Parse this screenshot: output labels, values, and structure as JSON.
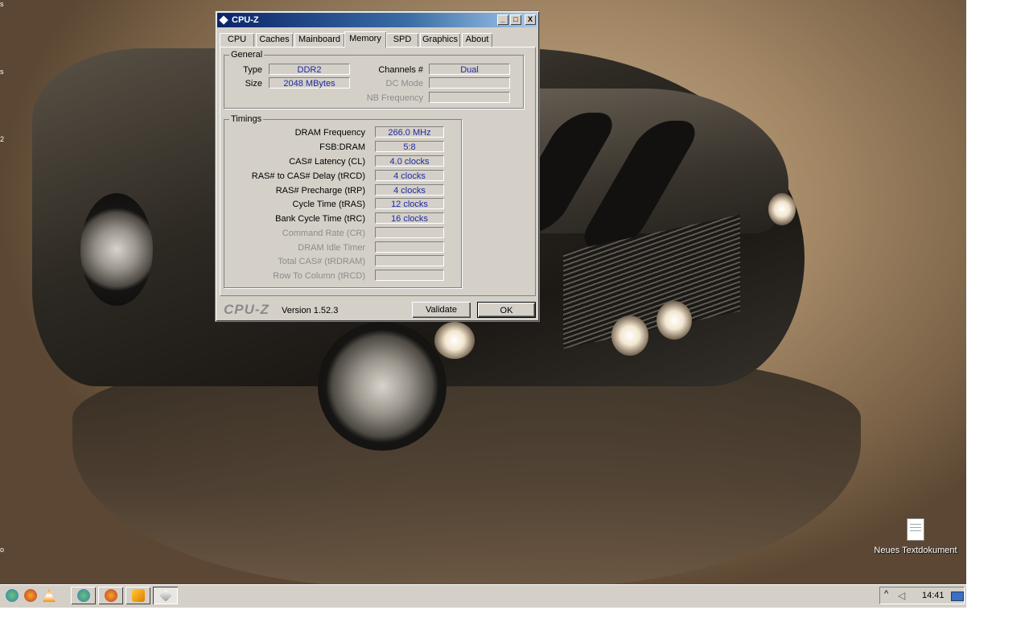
{
  "window": {
    "title": "CPU-Z",
    "controls": {
      "minimize": "_",
      "maximize": "□",
      "close": "X"
    },
    "tabs": [
      {
        "label": "CPU"
      },
      {
        "label": "Caches"
      },
      {
        "label": "Mainboard"
      },
      {
        "label": "Memory",
        "active": true
      },
      {
        "label": "SPD"
      },
      {
        "label": "Graphics"
      },
      {
        "label": "About"
      }
    ],
    "general": {
      "legend": "General",
      "type_label": "Type",
      "type_value": "DDR2",
      "size_label": "Size",
      "size_value": "2048 MBytes",
      "channels_label": "Channels #",
      "channels_value": "Dual",
      "dc_mode_label": "DC Mode",
      "dc_mode_value": "",
      "nb_freq_label": "NB Frequency",
      "nb_freq_value": ""
    },
    "timings": {
      "legend": "Timings",
      "rows": [
        {
          "label": "DRAM Frequency",
          "value": "266.0 MHz",
          "enabled": true
        },
        {
          "label": "FSB:DRAM",
          "value": "5:8",
          "enabled": true
        },
        {
          "label": "CAS# Latency (CL)",
          "value": "4.0 clocks",
          "enabled": true
        },
        {
          "label": "RAS# to CAS# Delay (tRCD)",
          "value": "4 clocks",
          "enabled": true
        },
        {
          "label": "RAS# Precharge (tRP)",
          "value": "4 clocks",
          "enabled": true
        },
        {
          "label": "Cycle Time (tRAS)",
          "value": "12 clocks",
          "enabled": true
        },
        {
          "label": "Bank Cycle Time (tRC)",
          "value": "16 clocks",
          "enabled": true
        },
        {
          "label": "Command Rate (CR)",
          "value": "",
          "enabled": false
        },
        {
          "label": "DRAM Idle Timer",
          "value": "",
          "enabled": false
        },
        {
          "label": "Total CAS# (tRDRAM)",
          "value": "",
          "enabled": false
        },
        {
          "label": "Row To Column (tRCD)",
          "value": "",
          "enabled": false
        }
      ]
    },
    "footer": {
      "logo": "CPU-Z",
      "version": "Version 1.52.3",
      "validate_label": "Validate",
      "ok_label": "OK"
    }
  },
  "desktop": {
    "icons": [
      {
        "label": "Neues Textdokument"
      }
    ],
    "edge_marks": [
      "s",
      "s",
      "2",
      "o"
    ]
  },
  "taskbar": {
    "quick_launch": [
      "users-icon",
      "firefox-icon",
      "vlc-icon"
    ],
    "tasks": [
      "users-icon",
      "firefox-icon",
      "media-player-icon",
      "cpuz-icon"
    ],
    "clock": "14:41",
    "tray_icons": [
      "show-hidden-icons-icon",
      "speaker-icon",
      "network-icon"
    ]
  },
  "colors": {
    "value_text": "#1f2aa0",
    "title_bar": "#0a246a",
    "face": "#d4d0c8"
  }
}
